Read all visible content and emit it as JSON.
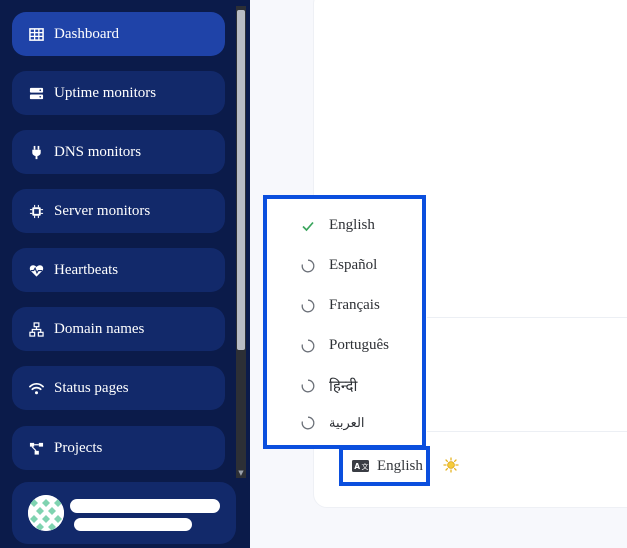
{
  "sidebar": {
    "items": [
      {
        "label": "Dashboard",
        "icon": "grid-icon",
        "active": true
      },
      {
        "label": "Uptime monitors",
        "icon": "server-icon"
      },
      {
        "label": "DNS monitors",
        "icon": "plug-icon"
      },
      {
        "label": "Server monitors",
        "icon": "cpu-icon"
      },
      {
        "label": "Heartbeats",
        "icon": "heartbeat-icon"
      },
      {
        "label": "Domain names",
        "icon": "sitemap-icon"
      },
      {
        "label": "Status pages",
        "icon": "wifi-icon"
      },
      {
        "label": "Projects",
        "icon": "project-diagram-icon"
      }
    ]
  },
  "language_menu": {
    "options": [
      {
        "label": "English",
        "selected": true
      },
      {
        "label": "Español",
        "selected": false
      },
      {
        "label": "Français",
        "selected": false
      },
      {
        "label": "Português",
        "selected": false
      },
      {
        "label": "हिन्दी",
        "selected": false
      },
      {
        "label": "العربية",
        "selected": false
      }
    ],
    "current_label": "English"
  },
  "colors": {
    "sidebar_bg": "#0b1b4a",
    "nav_item_bg": "#12296a",
    "nav_active_bg": "#1f43a8",
    "highlight_border": "#0b4fde",
    "check_green": "#3aa55d"
  }
}
